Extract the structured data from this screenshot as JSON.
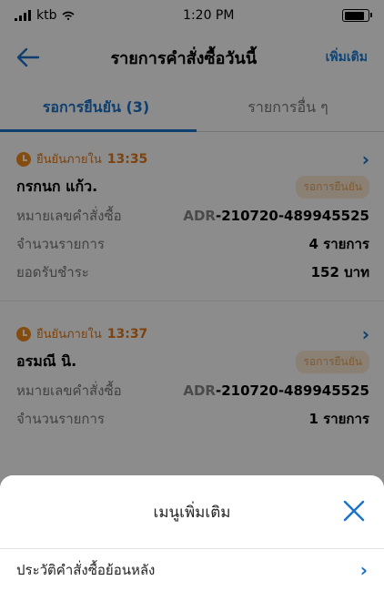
{
  "status_bar": {
    "carrier": "ktb",
    "time": "1:20 PM",
    "battery_level": 0.95
  },
  "navbar": {
    "title": "รายการคำสั่งซื้อวันนี้",
    "add_label": "เพิ่มเติม"
  },
  "tabs": [
    {
      "label": "รอการยืนยัน (3)",
      "active": true
    },
    {
      "label": "รายการอื่น ๆ",
      "active": false
    }
  ],
  "orders": [
    {
      "deadline_label": "ยืนยันภายใน",
      "deadline_time": "13:35",
      "customer": "กรกนก แก้ว.",
      "status": "รอการยืนยัน",
      "order_label": "หมายเลขคำสั่งซื้อ",
      "order_prefix": "ADR",
      "order_suffix": "-210720-489945525",
      "count_label": "จำนวนรายการ",
      "count_value": "4 รายการ",
      "total_label": "ยอดรับชำระ",
      "total_value": "152 บาท"
    },
    {
      "deadline_label": "ยืนยันภายใน",
      "deadline_time": "13:37",
      "customer": "อรมณี นิ.",
      "status": "รอการยืนยัน",
      "order_label": "หมายเลขคำสั่งซื้อ",
      "order_prefix": "ADR",
      "order_suffix": "-210720-489945525",
      "count_label": "จำนวนรายการ",
      "count_value": "1 รายการ"
    }
  ],
  "sheet": {
    "title": "เมนูเพิ่มเติม",
    "items": [
      {
        "label": "ประวัติคำสั่งซื้อย้อนหลัง"
      }
    ]
  },
  "colors": {
    "accent": "#1a73c8",
    "warning": "#f08a1d",
    "badge_bg": "#fbe9d4"
  },
  "icons": {
    "back": "arrow-left-icon",
    "close": "close-x-icon",
    "chevron": "chevron-right-icon",
    "clock": "clock-icon"
  }
}
